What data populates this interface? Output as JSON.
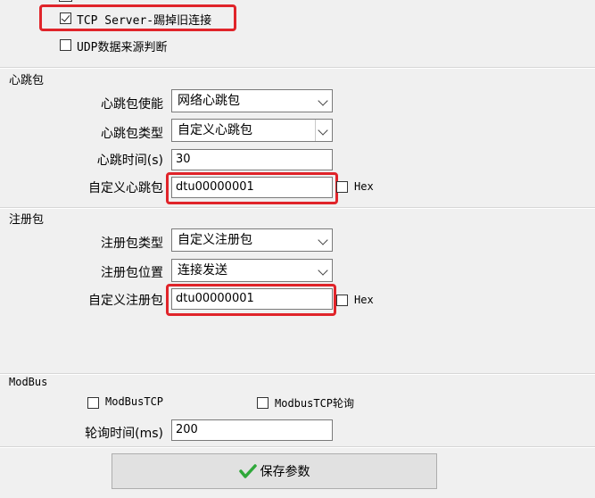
{
  "top": {
    "tcp_server_kick_label": "TCP Server-踢掉旧连接",
    "tcp_server_kick_checked": true,
    "udp_source_label": "UDP数据来源判断",
    "udp_source_checked": false
  },
  "heartbeat": {
    "group_title": "心跳包",
    "enable_label": "心跳包使能",
    "enable_value": "网络心跳包",
    "type_label": "心跳包类型",
    "type_value": "自定义心跳包",
    "time_label": "心跳时间(s)",
    "time_value": "30",
    "custom_label": "自定义心跳包",
    "custom_value": "dtu00000001",
    "hex_label": "Hex",
    "hex_checked": false
  },
  "register": {
    "group_title": "注册包",
    "type_label": "注册包类型",
    "type_value": "自定义注册包",
    "position_label": "注册包位置",
    "position_value": "连接发送",
    "custom_label": "自定义注册包",
    "custom_value": "dtu00000001",
    "hex_label": "Hex",
    "hex_checked": false
  },
  "modbus": {
    "group_title": "ModBus",
    "modbustcp_label": "ModBusTCP",
    "modbustcp_checked": false,
    "modbustcp_poll_label": "ModbusTCP轮询",
    "modbustcp_poll_checked": false,
    "poll_time_label": "轮询时间(ms)",
    "poll_time_value": "200"
  },
  "actions": {
    "save_label": "保存参数",
    "save_icon": "checkmark-icon",
    "save_icon_color": "#2fa83a"
  },
  "highlight_color": "#e0242a"
}
